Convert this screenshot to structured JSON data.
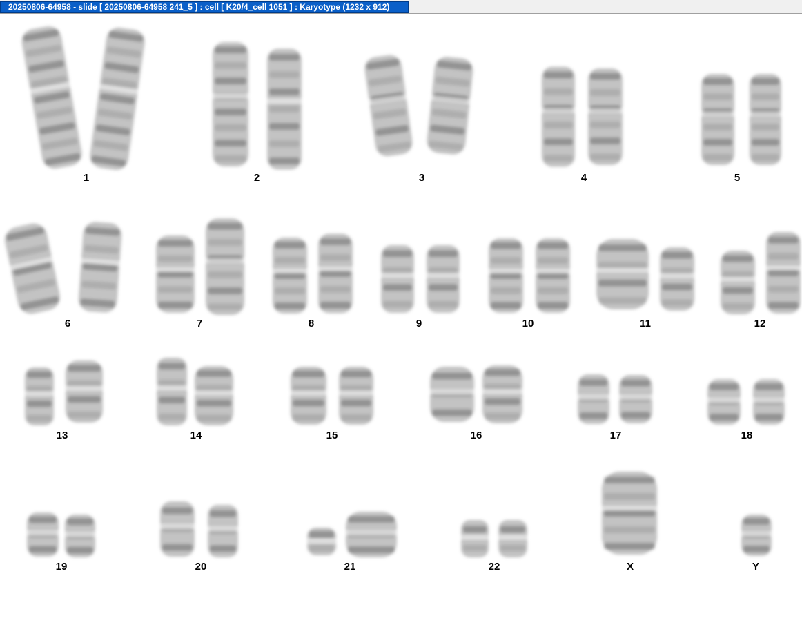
{
  "window": {
    "title": "20250806-64958 - slide [ 20250806-64958 241_5 ] : cell [ K20/4_cell 1051 ] : Karyotype  (1232 x 912)",
    "title_bg_color": "#0a5fc8",
    "bar_bg_color": "#f0f0f0"
  },
  "karyotype": {
    "background_color": "#ffffff",
    "chromosome_color": "#6e6e6e",
    "label_color": "#000000",
    "labels": {
      "c1": "1",
      "c2": "2",
      "c3": "3",
      "c4": "4",
      "c5": "5",
      "c6": "6",
      "c7": "7",
      "c8": "8",
      "c9": "9",
      "c10": "10",
      "c11": "11",
      "c12": "12",
      "c13": "13",
      "c14": "14",
      "c15": "15",
      "c16": "16",
      "c17": "17",
      "c18": "18",
      "c19": "19",
      "c20": "20",
      "c21": "21",
      "c22": "22",
      "cX": "X",
      "cY": "Y"
    }
  }
}
